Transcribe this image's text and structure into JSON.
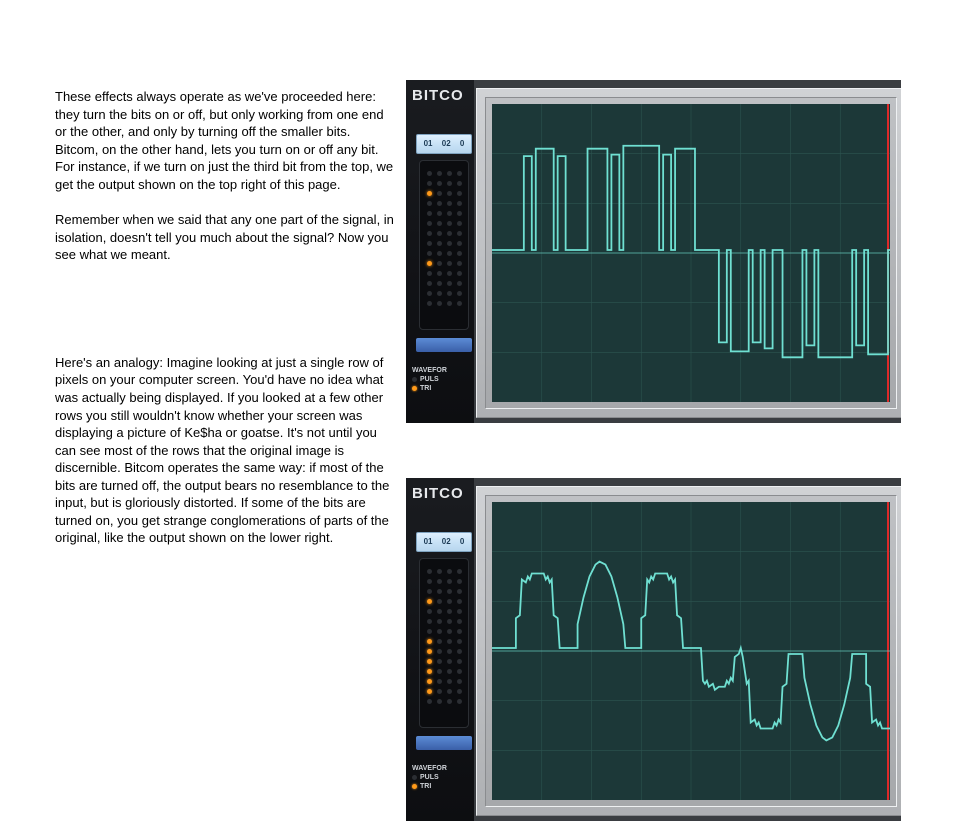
{
  "text": {
    "p1": "These effects always operate as we've proceeded here: they turn the bits on or off, but only working from one end or the other, and only by turning off the smaller bits. Bitcom, on the other hand, lets you turn on or off any bit. For instance, if we turn on just the third bit from the top, we get the output shown on the top right of this page.",
    "p2": "Remember when we said that any one part of the signal, in isolation, doesn't tell you much about the signal? Now you see what we meant.",
    "p3": "Here's an analogy: Imagine looking at just a single row of pixels on your computer screen. You'd have no idea what was actually being displayed. If you looked at a few other rows you still wouldn't know whether your screen was displaying a picture of Ke$ha or goatse. It's not until you can see most of the rows that the original image is discernible. Bitcom operates the same way: if most of the bits are turned off, the output bears no resemblance to the input, but is gloriously distorted. If some of the bits are turned on, you get strange conglomerations of parts of the original, like the output shown on the lower right."
  },
  "panel": {
    "brand": "BITCO",
    "tabs": {
      "a": "01",
      "b": "02",
      "c": "0"
    },
    "labels": {
      "wave": "WAVEFOR",
      "puls": "PULS",
      "tri": "TRI"
    }
  },
  "led_top_on_rows": [
    2,
    9
  ],
  "led_bot_on_rows": [
    3,
    7,
    8,
    9,
    10,
    11,
    12
  ],
  "chart_data": [
    {
      "type": "line",
      "id": "scope-top",
      "description": "Bitcom output with only one bit (third from top) enabled — rectangular step pulses",
      "xrange": [
        0,
        400
      ],
      "yrange": [
        -1,
        1
      ],
      "baseline": 0,
      "series": [
        {
          "name": "signal",
          "points": [
            [
              0,
              0.02
            ],
            [
              32,
              0.02
            ],
            [
              32,
              0.65
            ],
            [
              40,
              0.65
            ],
            [
              40,
              0.02
            ],
            [
              44,
              0.02
            ],
            [
              44,
              0.7
            ],
            [
              62,
              0.7
            ],
            [
              62,
              0.02
            ],
            [
              66,
              0.02
            ],
            [
              66,
              0.65
            ],
            [
              74,
              0.65
            ],
            [
              74,
              0.02
            ],
            [
              96,
              0.02
            ],
            [
              96,
              0.7
            ],
            [
              116,
              0.7
            ],
            [
              116,
              0.02
            ],
            [
              120,
              0.02
            ],
            [
              120,
              0.66
            ],
            [
              128,
              0.66
            ],
            [
              128,
              0.02
            ],
            [
              132,
              0.02
            ],
            [
              132,
              0.72
            ],
            [
              168,
              0.72
            ],
            [
              168,
              0.02
            ],
            [
              172,
              0.02
            ],
            [
              172,
              0.66
            ],
            [
              180,
              0.66
            ],
            [
              180,
              0.02
            ],
            [
              184,
              0.02
            ],
            [
              184,
              0.7
            ],
            [
              204,
              0.7
            ],
            [
              204,
              0.02
            ],
            [
              228,
              0.02
            ],
            [
              228,
              -0.6
            ],
            [
              236,
              -0.6
            ],
            [
              236,
              0.02
            ],
            [
              240,
              0.02
            ],
            [
              240,
              -0.66
            ],
            [
              258,
              -0.66
            ],
            [
              258,
              0.02
            ],
            [
              262,
              0.02
            ],
            [
              262,
              -0.6
            ],
            [
              270,
              -0.6
            ],
            [
              270,
              0.02
            ],
            [
              274,
              0.02
            ],
            [
              274,
              -0.64
            ],
            [
              282,
              -0.64
            ],
            [
              282,
              0.02
            ],
            [
              292,
              0.02
            ],
            [
              292,
              -0.7
            ],
            [
              312,
              -0.7
            ],
            [
              312,
              0.02
            ],
            [
              316,
              0.02
            ],
            [
              316,
              -0.62
            ],
            [
              324,
              -0.62
            ],
            [
              324,
              0.02
            ],
            [
              328,
              0.02
            ],
            [
              328,
              -0.7
            ],
            [
              362,
              -0.7
            ],
            [
              362,
              0.02
            ],
            [
              366,
              0.02
            ],
            [
              366,
              -0.62
            ],
            [
              374,
              -0.62
            ],
            [
              374,
              0.02
            ],
            [
              378,
              0.02
            ],
            [
              378,
              -0.68
            ],
            [
              398,
              -0.68
            ],
            [
              398,
              0.02
            ],
            [
              400,
              0.02
            ]
          ]
        }
      ]
    },
    {
      "type": "line",
      "id": "scope-bottom",
      "description": "Bitcom output with several bits enabled — jagged stepped approximation of a sine",
      "xrange": [
        0,
        400
      ],
      "yrange": [
        -1,
        1
      ],
      "baseline": 0,
      "series": [
        {
          "name": "signal",
          "points": [
            [
              0,
              0.02
            ],
            [
              24,
              0.02
            ],
            [
              24,
              0.22
            ],
            [
              28,
              0.24
            ],
            [
              30,
              0.48
            ],
            [
              34,
              0.46
            ],
            [
              36,
              0.5
            ],
            [
              38,
              0.48
            ],
            [
              40,
              0.52
            ],
            [
              52,
              0.52
            ],
            [
              54,
              0.48
            ],
            [
              56,
              0.5
            ],
            [
              58,
              0.46
            ],
            [
              60,
              0.48
            ],
            [
              62,
              0.24
            ],
            [
              66,
              0.22
            ],
            [
              68,
              0.02
            ],
            [
              86,
              0.02
            ],
            [
              86,
              0.18
            ],
            [
              92,
              0.36
            ],
            [
              98,
              0.5
            ],
            [
              104,
              0.58
            ],
            [
              108,
              0.6
            ],
            [
              114,
              0.58
            ],
            [
              120,
              0.5
            ],
            [
              126,
              0.36
            ],
            [
              132,
              0.18
            ],
            [
              134,
              0.02
            ],
            [
              150,
              0.02
            ],
            [
              150,
              0.22
            ],
            [
              154,
              0.24
            ],
            [
              156,
              0.48
            ],
            [
              158,
              0.46
            ],
            [
              160,
              0.5
            ],
            [
              162,
              0.48
            ],
            [
              164,
              0.52
            ],
            [
              176,
              0.52
            ],
            [
              178,
              0.48
            ],
            [
              180,
              0.5
            ],
            [
              182,
              0.46
            ],
            [
              184,
              0.48
            ],
            [
              186,
              0.24
            ],
            [
              190,
              0.22
            ],
            [
              192,
              0.02
            ],
            [
              210,
              0.02
            ],
            [
              212,
              -0.2
            ],
            [
              214,
              -0.22
            ],
            [
              216,
              -0.2
            ],
            [
              218,
              -0.24
            ],
            [
              222,
              -0.22
            ],
            [
              224,
              -0.26
            ],
            [
              228,
              -0.24
            ],
            [
              234,
              -0.24
            ],
            [
              236,
              -0.2
            ],
            [
              238,
              -0.22
            ],
            [
              240,
              -0.18
            ],
            [
              242,
              -0.2
            ],
            [
              244,
              -0.04
            ],
            [
              248,
              -0.02
            ],
            [
              250,
              0.02
            ],
            [
              252,
              -0.04
            ],
            [
              256,
              -0.22
            ],
            [
              258,
              -0.2
            ],
            [
              260,
              -0.48
            ],
            [
              264,
              -0.46
            ],
            [
              266,
              -0.5
            ],
            [
              268,
              -0.48
            ],
            [
              270,
              -0.52
            ],
            [
              282,
              -0.52
            ],
            [
              284,
              -0.48
            ],
            [
              286,
              -0.5
            ],
            [
              288,
              -0.46
            ],
            [
              290,
              -0.48
            ],
            [
              292,
              -0.24
            ],
            [
              296,
              -0.22
            ],
            [
              298,
              -0.02
            ],
            [
              312,
              -0.02
            ],
            [
              314,
              -0.18
            ],
            [
              320,
              -0.36
            ],
            [
              326,
              -0.5
            ],
            [
              332,
              -0.58
            ],
            [
              336,
              -0.6
            ],
            [
              342,
              -0.58
            ],
            [
              348,
              -0.5
            ],
            [
              354,
              -0.36
            ],
            [
              360,
              -0.18
            ],
            [
              362,
              -0.02
            ],
            [
              376,
              -0.02
            ],
            [
              376,
              -0.22
            ],
            [
              380,
              -0.24
            ],
            [
              382,
              -0.48
            ],
            [
              386,
              -0.46
            ],
            [
              388,
              -0.5
            ],
            [
              390,
              -0.48
            ],
            [
              392,
              -0.52
            ],
            [
              400,
              -0.52
            ]
          ]
        }
      ]
    }
  ],
  "colors": {
    "scope_bg": "#1c3838",
    "grid": "#2c5450",
    "trace": "#6fe0d2",
    "red_edge": "#e02a2a"
  }
}
